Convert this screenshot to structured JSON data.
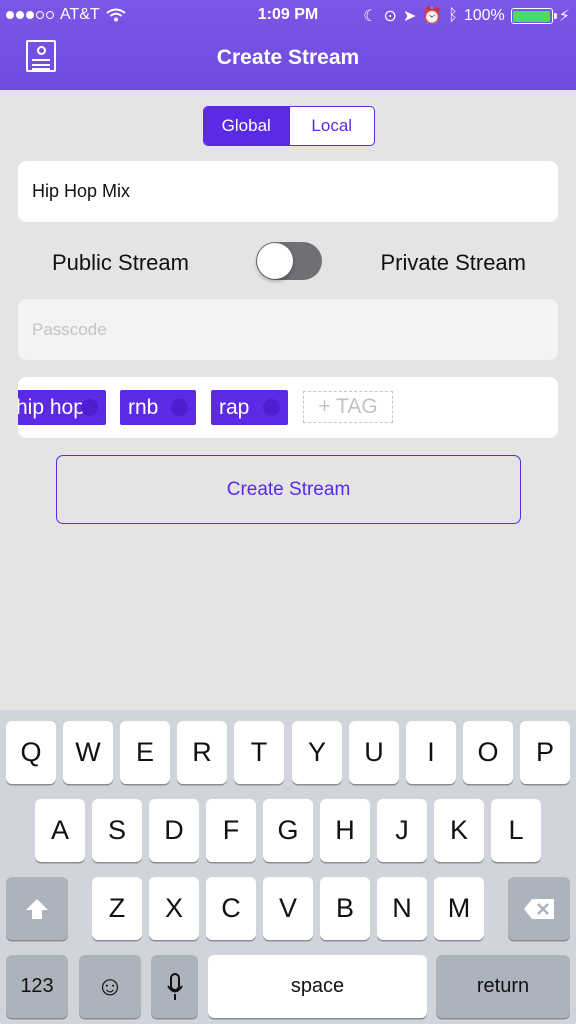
{
  "status_bar": {
    "carrier": "AT&T",
    "time": "1:09 PM",
    "battery": "100%"
  },
  "nav": {
    "title": "Create Stream",
    "left_icon": "contact-card-icon"
  },
  "segment": {
    "options": [
      "Global",
      "Local"
    ],
    "selected": "Global"
  },
  "stream_name": {
    "value": "Hip Hop Mix"
  },
  "visibility": {
    "public_label": "Public Stream",
    "private_label": "Private Stream",
    "is_private": false
  },
  "passcode": {
    "placeholder": "Passcode"
  },
  "tags": {
    "items": [
      "hip hop",
      "rnb",
      "rap"
    ],
    "add_label": "+ TAG"
  },
  "create_button": {
    "label": "Create Stream"
  },
  "keyboard": {
    "row1": [
      "Q",
      "W",
      "E",
      "R",
      "T",
      "Y",
      "U",
      "I",
      "O",
      "P"
    ],
    "row2": [
      "A",
      "S",
      "D",
      "F",
      "G",
      "H",
      "J",
      "K",
      "L"
    ],
    "row3": [
      "Z",
      "X",
      "C",
      "V",
      "B",
      "N",
      "M"
    ],
    "numbers_label": "123",
    "space_label": "space",
    "return_label": "return"
  },
  "colors": {
    "accent": "#5a2ae6",
    "header": "#7452e3",
    "toggle_track": "#6f6f74"
  }
}
